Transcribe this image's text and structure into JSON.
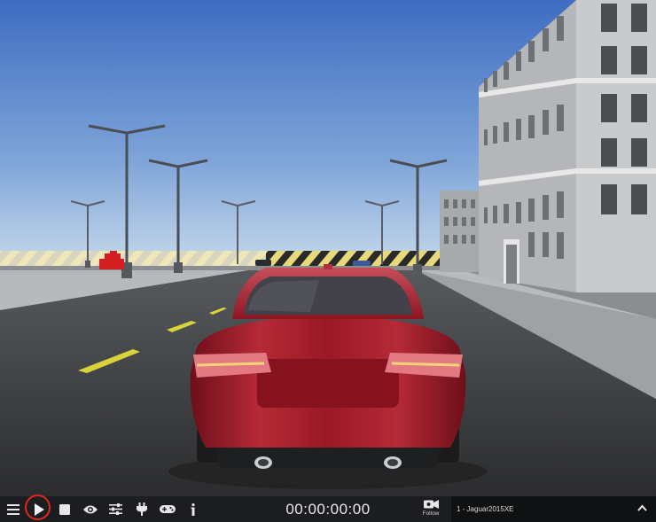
{
  "toolbar": {
    "timer": "00:00:00:00",
    "follow_label": "Follow",
    "vehicle_label": "1 - Jaguar2015XE",
    "icons": [
      "menu-icon",
      "play-icon",
      "stop-icon",
      "eye-icon",
      "sliders-icon",
      "plug-icon",
      "gamepad-icon",
      "info-icon",
      "camera-icon",
      "chevron-up-icon"
    ]
  },
  "colors": {
    "toolbar_bg": "#1c1d20",
    "vehicle_panel_bg": "#101113",
    "play_highlight": "#e0271d",
    "car_body": "#9b1826",
    "sky_top": "#3e6cc1",
    "sky_bottom": "#c5d8ec"
  }
}
